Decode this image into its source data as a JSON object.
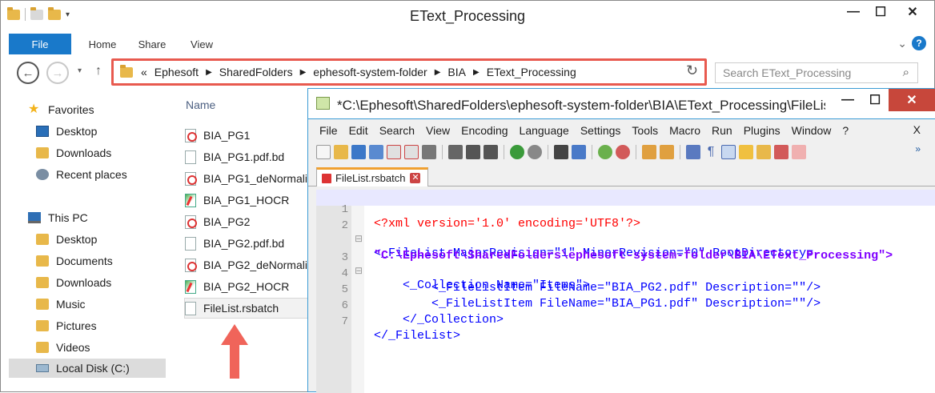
{
  "explorer": {
    "title": "EText_Processing",
    "ribbon_tabs": [
      "File",
      "Home",
      "Share",
      "View"
    ],
    "breadcrumb": [
      "«",
      "Ephesoft",
      "SharedFolders",
      "ephesoft-system-folder",
      "BIA",
      "EText_Processing"
    ],
    "search_placeholder": "Search EText_Processing",
    "sidebar": {
      "favorites": "Favorites",
      "favorites_items": [
        "Desktop",
        "Downloads",
        "Recent places"
      ],
      "this_pc": "This PC",
      "pc_items": [
        "Desktop",
        "Documents",
        "Downloads",
        "Music",
        "Pictures",
        "Videos",
        "Local Disk (C:)"
      ]
    },
    "column_header": "Name",
    "files": [
      {
        "name": "BIA_PG1",
        "icon": "pdf-icon"
      },
      {
        "name": "BIA_PG1.pdf.bd",
        "icon": "file-icon"
      },
      {
        "name": "BIA_PG1_deNormalized",
        "icon": "pdf-icon"
      },
      {
        "name": "BIA_PG1_HOCR",
        "icon": "hocr-icon"
      },
      {
        "name": "BIA_PG2",
        "icon": "pdf-icon"
      },
      {
        "name": "BIA_PG2.pdf.bd",
        "icon": "file-icon"
      },
      {
        "name": "BIA_PG2_deNormalized",
        "icon": "pdf-icon"
      },
      {
        "name": "BIA_PG2_HOCR",
        "icon": "hocr-icon"
      },
      {
        "name": "FileList.rsbatch",
        "icon": "file-icon"
      }
    ],
    "window_buttons": {
      "minimize": "—",
      "maximize": "☐",
      "close": "✕"
    }
  },
  "notepad": {
    "title": "*C:\\Ephesoft\\SharedFolders\\ephesoft-system-folder\\BIA\\EText_Processing\\FileList.rsbatch - Notepad++",
    "menu": [
      "File",
      "Edit",
      "Search",
      "View",
      "Encoding",
      "Language",
      "Settings",
      "Tools",
      "Macro",
      "Run",
      "Plugins",
      "Window",
      "?"
    ],
    "menu_close": "X",
    "tab_label": "FileList.rsbatch",
    "tab_close": "✕",
    "more_tools": "»",
    "line_numbers": [
      "1",
      "2",
      "",
      "3",
      "4",
      "5",
      "6",
      "7"
    ],
    "code_lines": [
      "<?xml version='1.0' encoding='UTF8'?>",
      "<_FileList MajorRevision=\"1\" MinorRevision=\"0\" RootDirectory=",
      "\"C:\\Ephesoft\\SharedFolders\\ephesoft-system-folder\\BIA\\EText_Processing\">",
      "    <_Collection Name=\"Items\">",
      "        <_FileListItem FileName=\"BIA_PG2.pdf\" Description=\"\"/>",
      "        <_FileListItem FileName=\"BIA_PG1.pdf\" Description=\"\"/>",
      "    </_Collection>",
      "</_FileList>"
    ]
  },
  "colors": {
    "highlight": "#e85a4f",
    "accent": "#1979ca",
    "arrow": "#f0645a"
  }
}
